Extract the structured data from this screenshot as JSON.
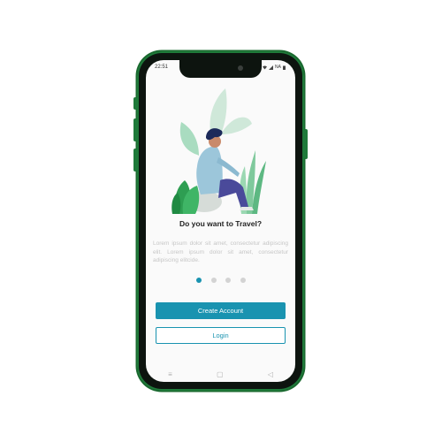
{
  "status_bar": {
    "time": "22:51",
    "battery": "NA"
  },
  "onboarding": {
    "title": "Do you want to Travel?",
    "description": "Lorem ipsum dolor sit amet, consectetur adipiscing elit. Lorem ipsum dolor sit amet, consectetur adipiscing elitcide.",
    "pages": 4,
    "active_page": 1
  },
  "actions": {
    "create_account_label": "Create Account",
    "login_label": "Login"
  },
  "colors": {
    "accent": "#1993b0",
    "frame": "#1f7a3a"
  },
  "icons": {
    "nav": [
      "recent-apps-icon",
      "home-icon",
      "back-icon"
    ]
  }
}
